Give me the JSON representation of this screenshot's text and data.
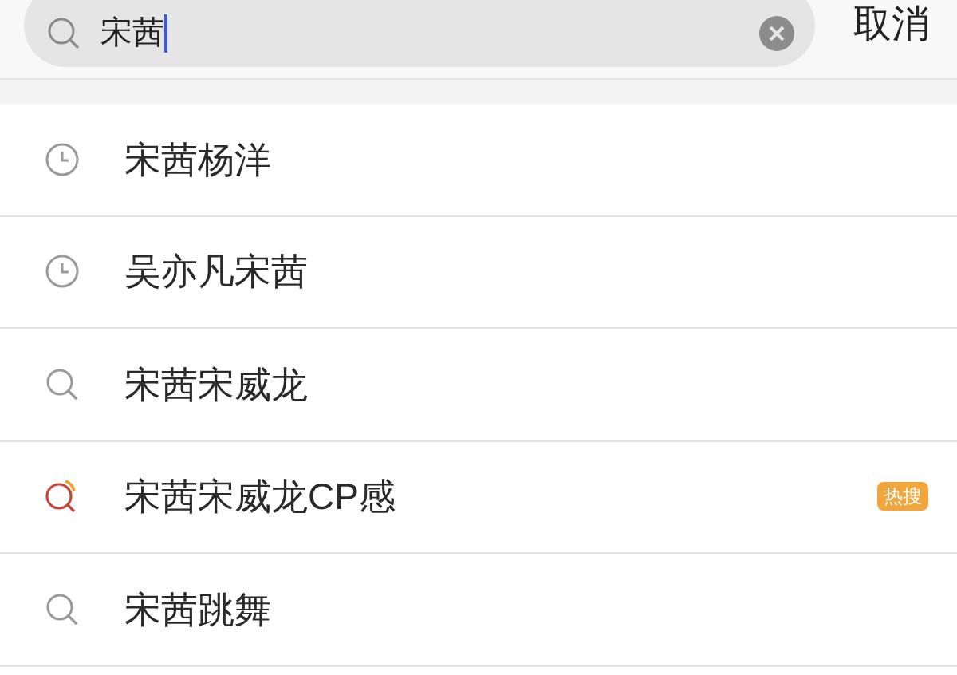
{
  "search": {
    "value": "宋茜"
  },
  "cancel": "取消",
  "suggestions": [
    {
      "kind": "history",
      "text": "宋茜杨洋"
    },
    {
      "kind": "history",
      "text": "吴亦凡宋茜"
    },
    {
      "kind": "search",
      "text": "宋茜宋威龙"
    },
    {
      "kind": "hot",
      "text": "宋茜宋威龙CP感",
      "badge": "热搜"
    },
    {
      "kind": "search",
      "text": "宋茜跳舞"
    }
  ]
}
